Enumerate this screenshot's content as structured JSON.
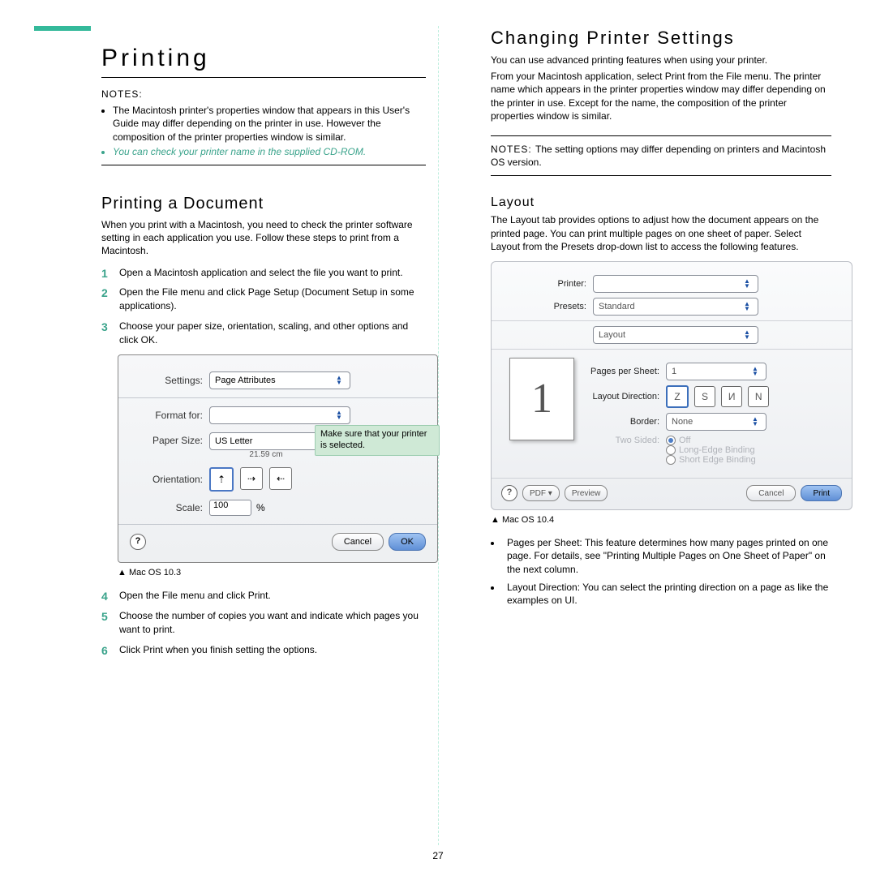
{
  "page_number": "27",
  "left": {
    "title": "Printing",
    "notes_label": "NOTES:",
    "notes": [
      "The Macintosh printer's properties window that appears in this User's Guide may differ depending on the printer in use. However the composition of the printer properties window is similar.",
      "You can check your printer name in the supplied CD-ROM."
    ],
    "sub1": "Printing a Document",
    "sub1_intro": "When you print with a Macintosh, you need to check the printer software setting in each application you use. Follow these steps to print from a Macintosh.",
    "steps_a": [
      "Open a Macintosh application and select the file you want to print.",
      "Open the File menu and click Page Setup (Document Setup in some applications).",
      "Choose your paper size, orientation, scaling, and other options and click OK."
    ],
    "caption1": "Mac OS 10.3",
    "steps_b": [
      "Open the File menu and click Print.",
      "Choose the number of copies you want and indicate which pages you want to print.",
      "Click Print when you finish setting the options."
    ]
  },
  "dlg1": {
    "settings_label": "Settings:",
    "settings_value": "Page Attributes",
    "format_for_label": "Format for:",
    "format_for_value": "",
    "paper_size_label": "Paper Size:",
    "paper_size_value": "US Letter",
    "paper_dim": "21.59 cm",
    "callout": "Make sure that your printer is selected.",
    "orientation_label": "Orientation:",
    "scale_label": "Scale:",
    "scale_value": "100",
    "scale_unit": "%",
    "cancel": "Cancel",
    "ok": "OK"
  },
  "right": {
    "title": "Changing Printer Settings",
    "p1": "You can use advanced printing features when using your printer.",
    "p2": "From your Macintosh application, select Print from the File menu. The printer name which appears in the printer properties window may differ depending on the printer in use. Except for the name, the composition of the printer properties window is similar.",
    "notes_label": "NOTES: ",
    "notes_text": "The setting options may differ depending on printers and Macintosh OS version.",
    "layout_h": "Layout",
    "layout_intro": "The Layout tab provides options to adjust how the document appears on the printed page. You can print multiple pages on one sheet of paper. Select Layout from the Presets drop-down list to access the following features.",
    "caption": "Mac OS 10.4",
    "bullets": [
      "Pages per Sheet: This feature determines how many pages printed on one page. For details, see \"Printing Multiple Pages on One Sheet of Paper\" on the next column.",
      "Layout Direction: You can select the printing direction on a page as like the examples on UI."
    ]
  },
  "dlg2": {
    "printer_label": "Printer:",
    "printer_value": "",
    "presets_label": "Presets:",
    "presets_value": "Standard",
    "pane_value": "Layout",
    "preview_number": "1",
    "pps_label": "Pages per Sheet:",
    "pps_value": "1",
    "ld_label": "Layout Direction:",
    "border_label": "Border:",
    "border_value": "None",
    "ts_label": "Two Sided:",
    "ts_opts": [
      "Off",
      "Long-Edge Binding",
      "Short Edge Binding"
    ],
    "pdf": "PDF ▾",
    "preview": "Preview",
    "cancel": "Cancel",
    "print": "Print"
  }
}
